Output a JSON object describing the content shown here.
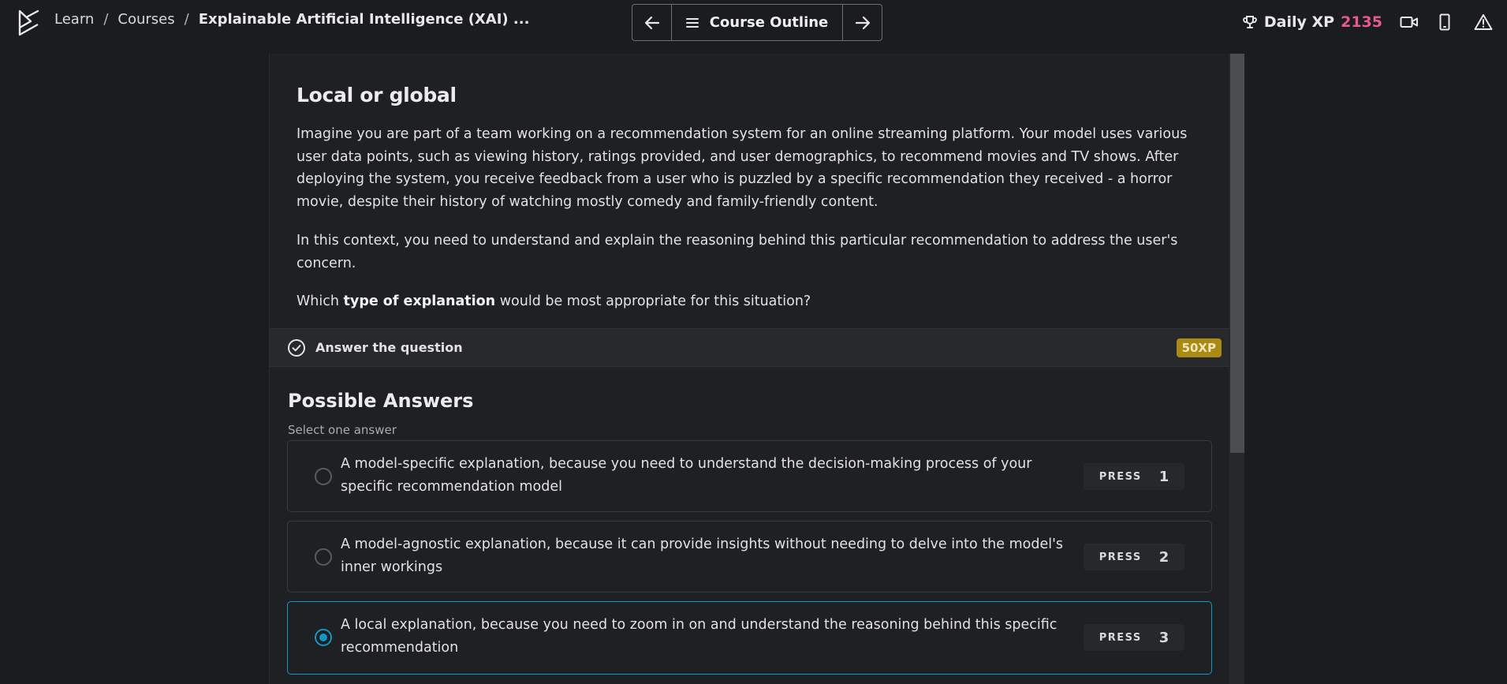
{
  "topbar": {
    "breadcrumb": {
      "learn": "Learn",
      "separator": "/",
      "courses": "Courses",
      "current": "Explainable Artificial Intelligence (XAI) ..."
    },
    "nav": {
      "prev_icon": "arrow-left-icon",
      "outline_icon": "menu-icon",
      "outline_label": "Course Outline",
      "next_icon": "arrow-right-icon"
    },
    "daily_xp_label": "Daily XP",
    "daily_xp_value": "2135",
    "xp_color": "#e75a8c",
    "icons": [
      "trophy-icon",
      "video-icon",
      "mobile-icon",
      "alert-icon"
    ]
  },
  "exercise": {
    "title": "Local or global",
    "paragraph1": "Imagine you are part of a team working on a recommendation system for an online streaming platform. Your model uses various user data points, such as viewing history, ratings provided, and user demographics, to recommend movies and TV shows. After deploying the system, you receive feedback from a user who is puzzled by a specific recommendation they received - a horror movie, despite their history of watching mostly comedy and family-friendly content.",
    "paragraph2": "In this context, you need to understand and explain the reasoning behind this particular recommendation to address the user's concern.",
    "question_prefix": "Which ",
    "question_bold": "type of explanation",
    "question_suffix": " would be most appropriate for this situation?"
  },
  "answer_bar": {
    "label": "Answer the question",
    "xp_badge": "50XP",
    "badge_color": "#a98b14"
  },
  "possible_answers": {
    "title": "Possible Answers",
    "subtitle": "Select one answer",
    "press_label": "PRESS",
    "selected_color": "#1596c8",
    "options": [
      {
        "text": "A model-specific explanation, because you need to understand the decision-making process of your specific recommendation model",
        "key": "1",
        "selected": false
      },
      {
        "text": "A model-agnostic explanation, because it can provide insights without needing to delve into the model's inner workings",
        "key": "2",
        "selected": false
      },
      {
        "text": "A local explanation, because you need to zoom in on and understand the reasoning behind this specific recommendation",
        "key": "3",
        "selected": true
      }
    ]
  }
}
